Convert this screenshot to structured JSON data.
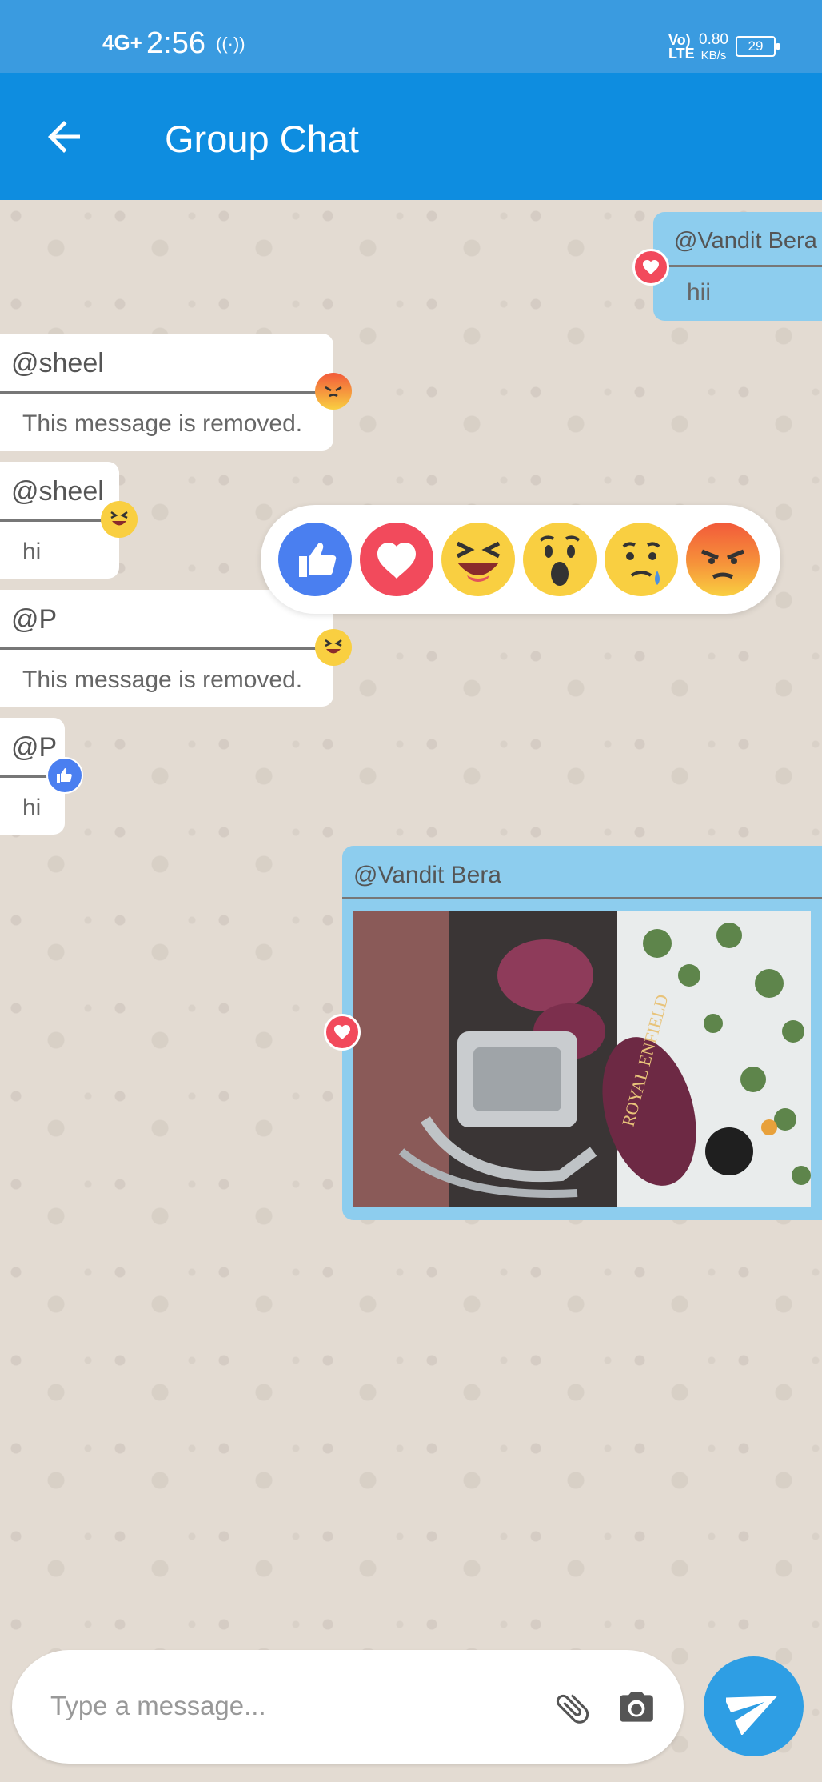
{
  "status_bar": {
    "network": "4G+",
    "time": "2:56",
    "hotspot_icon": "hotspot-icon",
    "volte": "Vo)\nLTE",
    "speed_value": "0.80",
    "speed_unit": "KB/s",
    "battery": "29"
  },
  "app_bar": {
    "title": "Group Chat",
    "back_icon": "arrow-left-icon",
    "color": "#0e8de0"
  },
  "messages": [
    {
      "side": "outgoing",
      "sender": "@Vandit Bera",
      "text": "hii",
      "reaction": "heart"
    },
    {
      "side": "incoming",
      "sender": "@sheel",
      "text": "This message is removed.",
      "reaction": "angry"
    },
    {
      "side": "incoming",
      "sender": "@sheel",
      "text": "hi",
      "reaction": "laugh"
    },
    {
      "side": "incoming",
      "sender": "@P",
      "text": "This message is removed.",
      "reaction": "laugh"
    },
    {
      "side": "incoming",
      "sender": "@P",
      "text": "hi",
      "reaction": "like"
    },
    {
      "side": "outgoing",
      "sender": "@Vandit Bera",
      "image": "royal-enfield-motorcycle-photo",
      "reaction": "heart"
    }
  ],
  "reaction_picker": [
    "like",
    "heart",
    "laugh",
    "wow",
    "sad",
    "angry"
  ],
  "composer": {
    "placeholder": "Type a message...",
    "attach_icon": "paperclip-icon",
    "camera_icon": "camera-icon",
    "send_icon": "send-icon"
  },
  "colors": {
    "status_bar": "#3a9be0",
    "outgoing_bubble": "#8dcdee",
    "incoming_bubble": "#ffffff",
    "send_button": "#2e9ee4",
    "like": "#4a7ff0",
    "heart": "#f24a5c",
    "emoji_yellow": "#f9cf41",
    "angry_red": "#f25a3a"
  }
}
